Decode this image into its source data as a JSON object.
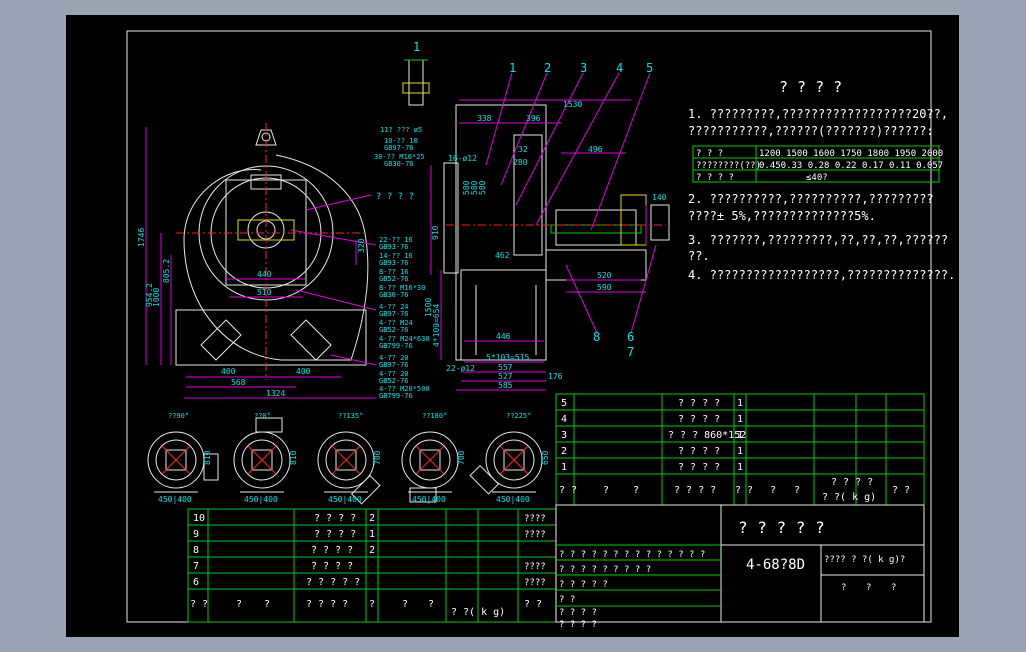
{
  "title_block": {
    "notes_title": "? ? ? ?",
    "notes": [
      "1. ?????????,??????????????????20??,",
      "???????????,??????(???????)??????:",
      "2. ??????????,??????????,?????????",
      "????± 5%,??????????????5%.",
      "3. ???????,?????????,??,??,??,??????",
      "??.",
      "4. ??????????????????,??????????????."
    ],
    "speed_table": {
      "row1_label": "? ? ?",
      "row1_values": "1200 1500 1600 1750 1800 1950 2000",
      "row2_label": "????????(??)",
      "row2_values": "0.450.33 0.28 0.22 0.17 0.11 0.057",
      "row3_label": "? ? ? ?",
      "row3_value": "≤40?"
    },
    "drawing_title": "? ? ? ? ?",
    "drawing_number": "4-68?8D",
    "weight_header": "???? ? ?( k g)?",
    "sign_labels": [
      "?",
      "?",
      "?"
    ]
  },
  "balloons": [
    "1",
    "2",
    "3",
    "4",
    "5",
    "8",
    "6",
    "7",
    "1"
  ],
  "dimensions": {
    "d1746": "1746",
    "d1000": "1000",
    "d8052": "805.2",
    "d9542": "954.2",
    "d440": "440",
    "d510": "510",
    "d400a": "400",
    "d400b": "400",
    "d568": "568",
    "d1324": "1324",
    "d1530": "1530",
    "d338": "338",
    "d396": "396",
    "d280": "280",
    "d32": "32",
    "d496": "496",
    "d520": "520",
    "d590": "590",
    "d446": "446",
    "d5x103": "5*103=515",
    "d557": "557",
    "d527": "527",
    "d585": "585",
    "d176": "176",
    "d140": "140",
    "d4x109": "4*109=654",
    "d1500": "1500",
    "d580a": "580",
    "d580b": "580",
    "d580c": "580",
    "d910": "910",
    "d1612": "16-ø12",
    "d2212": "22-ø12",
    "d462": "462",
    "d320": "320"
  },
  "callouts": {
    "c1": "11? ??? ø5",
    "c2": "10-?? 10",
    "c3": "GB97-76",
    "c4": "30-?? M16*25",
    "c5": "GB30-76",
    "c6": "? ? ? ?",
    "c7": "22-?? 16",
    "c8": "GB93-76",
    "c9": "14-?? 16",
    "c10": "GB93-76",
    "c11": "8-?? 16",
    "c12": "GB52-76",
    "c13": "8-?? M16*30",
    "c14": "GB30-76",
    "c15": "4-?? 24",
    "c16": "GB97-76",
    "c17": "4-?? M24",
    "c18": "GB52-76",
    "c19": "4-?? M24*630",
    "c20": "GB799-76",
    "c21": "4-?? 20",
    "c22": "GB97-76",
    "c23": "4-?? 20",
    "c24": "GB52-76",
    "c25": "4-?? M20*500",
    "c26": "GB799-76"
  },
  "variants": {
    "labels": [
      "??90°",
      "??0°",
      "??135°",
      "??180°",
      "??225°"
    ],
    "dims": [
      "450",
      "400",
      "810",
      "700",
      "650"
    ]
  },
  "bom_right": {
    "rows": [
      {
        "no": "5",
        "name": "? ? ? ?",
        "qty": "1"
      },
      {
        "no": "4",
        "name": "? ? ? ?",
        "qty": "1"
      },
      {
        "no": "3",
        "name": "? ? ?  860*152",
        "qty": "1"
      },
      {
        "no": "2",
        "name": "? ? ? ?",
        "qty": "1"
      },
      {
        "no": "1",
        "name": "? ? ? ?",
        "qty": "1"
      }
    ],
    "header": [
      "? ?",
      "?",
      "?",
      "? ? ? ?",
      "? ?",
      "?",
      "?",
      "?",
      "? ? ? ?",
      "? ?"
    ],
    "header_weight": "? ?( k g)"
  },
  "bom_left": {
    "rows": [
      {
        "no": "10",
        "name": "? ? ? ?",
        "qty": "2",
        "note": "????"
      },
      {
        "no": "9",
        "name": "? ? ? ?",
        "qty": "1",
        "note": "????"
      },
      {
        "no": "8",
        "name": "? ? ? ?",
        "qty": "2",
        "note": ""
      },
      {
        "no": "7",
        "name": "? ? ? ?",
        "qty": "",
        "note": "????"
      },
      {
        "no": "6",
        "name": "? ? ? ? ?",
        "qty": "",
        "note": "????"
      }
    ],
    "header": [
      "? ?",
      "?",
      "?",
      "? ? ? ?",
      "?",
      "?",
      "?"
    ],
    "header_weight": "? ?( k g)",
    "header_note": "? ?"
  },
  "revision_block": {
    "row1": "? ? ? ?   ? ? ? ? ? ? ? ?   ? ?",
    "row2": "? ? ? ?   ? ? ? ? ?",
    "row3": "? ?           ? ? ?",
    "row4": "? ?",
    "row5": "? ?           ? ?",
    "row6": "? ?           ? ?"
  }
}
